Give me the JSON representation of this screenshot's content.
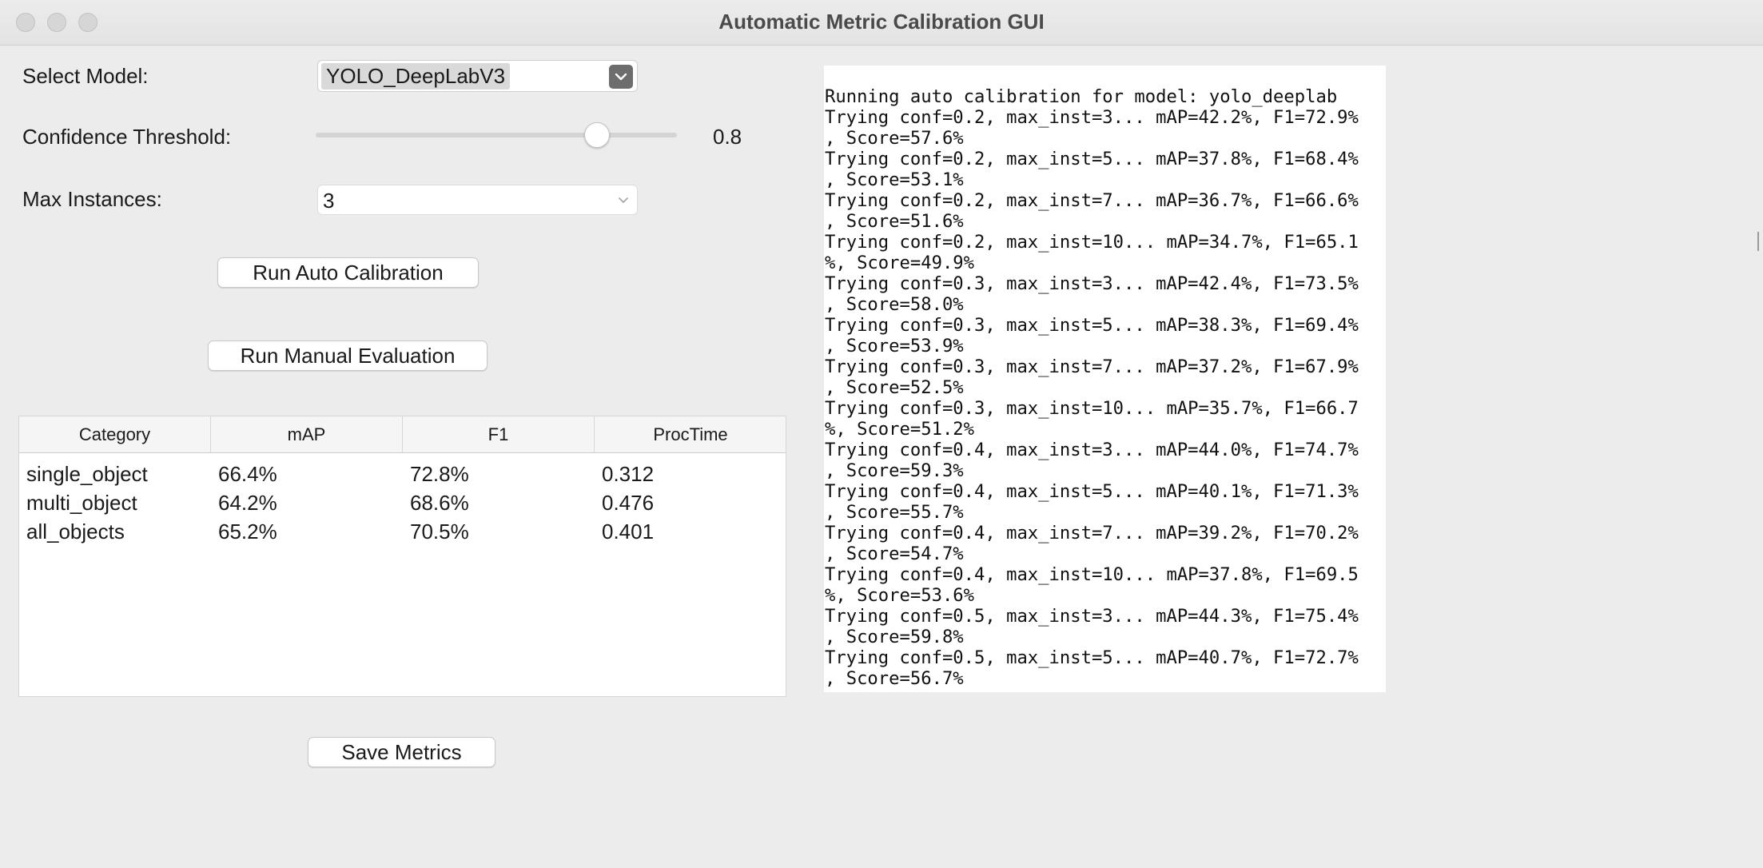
{
  "window": {
    "title": "Automatic Metric Calibration GUI"
  },
  "controls": {
    "model_label": "Select Model:",
    "model_value": "YOLO_DeepLabV3",
    "confidence_label": "Confidence Threshold:",
    "confidence_value": "0.8",
    "confidence_fraction": 0.8,
    "max_instances_label": "Max Instances:",
    "max_instances_value": "3"
  },
  "buttons": {
    "auto_calibration": "Run Auto Calibration",
    "manual_evaluation": "Run Manual Evaluation",
    "save_metrics": "Save Metrics"
  },
  "table": {
    "columns": [
      "Category",
      "mAP",
      "F1",
      "ProcTime"
    ],
    "rows": [
      [
        "single_object",
        "66.4%",
        "72.8%",
        "0.312"
      ],
      [
        "multi_object",
        "64.2%",
        "68.6%",
        "0.476"
      ],
      [
        "all_objects",
        "65.2%",
        "70.5%",
        "0.401"
      ]
    ]
  },
  "log": {
    "lines": [
      "Running auto calibration for model: yolo_deeplab",
      "Trying conf=0.2, max_inst=3... mAP=42.2%, F1=72.9%",
      ", Score=57.6%",
      "Trying conf=0.2, max_inst=5... mAP=37.8%, F1=68.4%",
      ", Score=53.1%",
      "Trying conf=0.2, max_inst=7... mAP=36.7%, F1=66.6%",
      ", Score=51.6%",
      "Trying conf=0.2, max_inst=10... mAP=34.7%, F1=65.1",
      "%, Score=49.9%",
      "Trying conf=0.3, max_inst=3... mAP=42.4%, F1=73.5%",
      ", Score=58.0%",
      "Trying conf=0.3, max_inst=5... mAP=38.3%, F1=69.4%",
      ", Score=53.9%",
      "Trying conf=0.3, max_inst=7... mAP=37.2%, F1=67.9%",
      ", Score=52.5%",
      "Trying conf=0.3, max_inst=10... mAP=35.7%, F1=66.7",
      "%, Score=51.2%",
      "Trying conf=0.4, max_inst=3... mAP=44.0%, F1=74.7%",
      ", Score=59.3%",
      "Trying conf=0.4, max_inst=5... mAP=40.1%, F1=71.3%",
      ", Score=55.7%",
      "Trying conf=0.4, max_inst=7... mAP=39.2%, F1=70.2%",
      ", Score=54.7%",
      "Trying conf=0.4, max_inst=10... mAP=37.8%, F1=69.5",
      "%, Score=53.6%",
      "Trying conf=0.5, max_inst=3... mAP=44.3%, F1=75.4%",
      ", Score=59.8%",
      "Trying conf=0.5, max_inst=5... mAP=40.7%, F1=72.7%",
      ", Score=56.7%"
    ]
  }
}
